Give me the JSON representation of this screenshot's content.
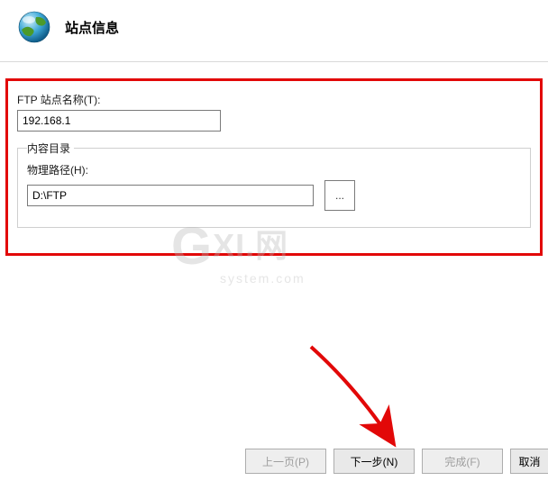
{
  "header": {
    "title": "站点信息"
  },
  "form": {
    "site_name_label": "FTP 站点名称(T):",
    "site_name_value": "192.168.1",
    "content_dir_group": "内容目录",
    "physical_path_label": "物理路径(H):",
    "physical_path_value": "D:\\FTP",
    "browse_label": "..."
  },
  "footer": {
    "prev": "上一页(P)",
    "next": "下一步(N)",
    "finish": "完成(F)",
    "cancel": "取消"
  },
  "watermark": {
    "main": "XI.网",
    "sub": "system.com"
  }
}
